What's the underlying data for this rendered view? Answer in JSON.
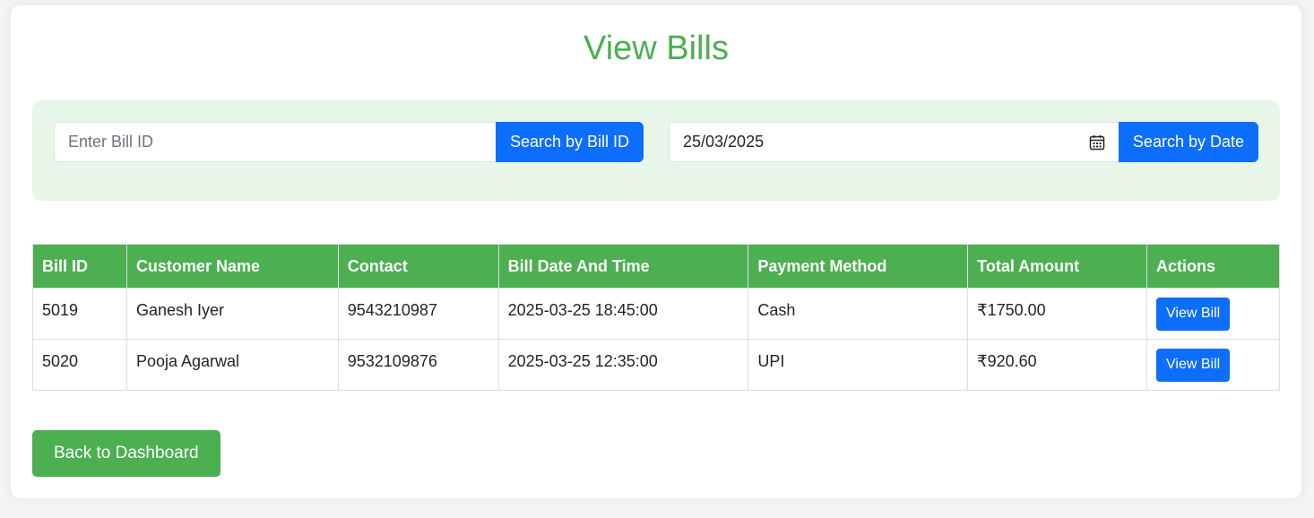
{
  "page": {
    "title": "View Bills"
  },
  "search": {
    "bill_id_placeholder": "Enter Bill ID",
    "bill_id_value": "",
    "bill_id_button": "Search by Bill ID",
    "date_value": "25/03/2025",
    "date_button": "Search by Date",
    "date_icon": "calendar-icon"
  },
  "table": {
    "headers": [
      "Bill ID",
      "Customer Name",
      "Contact",
      "Bill Date And Time",
      "Payment Method",
      "Total Amount",
      "Actions"
    ],
    "rows": [
      {
        "bill_id": "5019",
        "customer": "Ganesh Iyer",
        "contact": "9543210987",
        "datetime": "2025-03-25 18:45:00",
        "payment": "Cash",
        "amount": "₹1750.00",
        "action": "View Bill"
      },
      {
        "bill_id": "5020",
        "customer": "Pooja Agarwal",
        "contact": "9532109876",
        "datetime": "2025-03-25 12:35:00",
        "payment": "UPI",
        "amount": "₹920.60",
        "action": "View Bill"
      }
    ]
  },
  "footer": {
    "back_button": "Back to Dashboard"
  },
  "colors": {
    "accent_green": "#4caf50",
    "panel_green": "#e8f5e9",
    "primary_blue": "#0d6efd"
  }
}
